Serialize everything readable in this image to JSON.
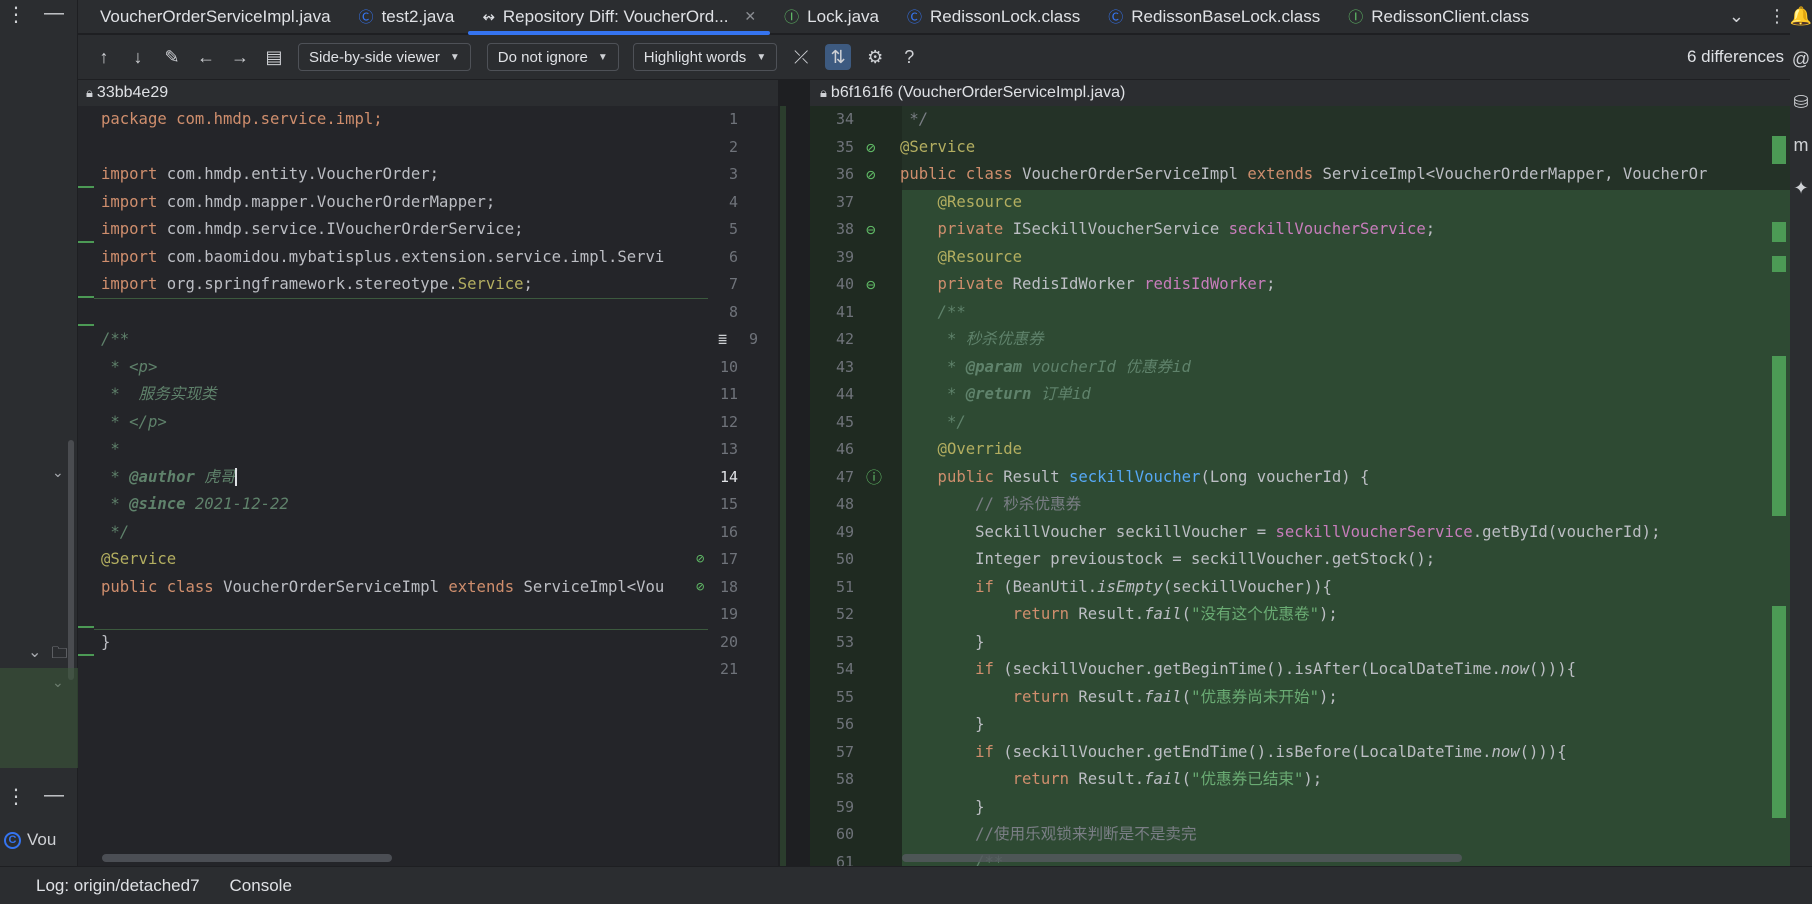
{
  "tabs": [
    {
      "label": "VoucherOrderServiceImpl.java",
      "icon": "file-icon",
      "active": false
    },
    {
      "label": "test2.java",
      "icon": "class-icon",
      "active": false
    },
    {
      "label": "Repository Diff: VoucherOrd...",
      "icon": "diff-icon",
      "active": true
    },
    {
      "label": "Lock.java",
      "icon": "interface-icon",
      "active": false
    },
    {
      "label": "RedissonLock.class",
      "icon": "class-icon",
      "active": false
    },
    {
      "label": "RedissonBaseLock.class",
      "icon": "class-icon",
      "active": false
    },
    {
      "label": "RedissonClient.class",
      "icon": "interface-icon",
      "active": false
    }
  ],
  "toolbar": {
    "viewer": "Side-by-side viewer",
    "ignore": "Do not ignore",
    "highlight": "Highlight words",
    "differences": "6 differences",
    "help": "?"
  },
  "left_pane": {
    "revision": "33bb4e29",
    "current_line": 14
  },
  "right_pane": {
    "revision": "b6f161f6 (VoucherOrderServiceImpl.java)"
  },
  "left_code": {
    "l1": "package com.hmdp.service.impl;",
    "l3a": "import ",
    "l3b": "com.hmdp.entity.VoucherOrder;",
    "l4a": "import ",
    "l4b": "com.hmdp.mapper.VoucherOrderMapper;",
    "l5a": "import ",
    "l5b": "com.hmdp.service.IVoucherOrderService;",
    "l6a": "import ",
    "l6b": "com.baomidou.mybatisplus.extension.service.impl.Servi",
    "l7a": "import ",
    "l7b": "org.springframework.stereotype.",
    "l7c": "Service",
    "l7d": ";",
    "l9": "/**",
    "l10a": " * ",
    "l10b": "<p>",
    "l11": " *  服务实现类",
    "l12a": " * ",
    "l12b": "</p>",
    "l13": " *",
    "l14a": " * ",
    "l14b": "@author",
    "l14c": " 虎哥",
    "l15a": " * ",
    "l15b": "@since",
    "l15c": " 2021-12-22",
    "l16": " */",
    "l17": "@Service",
    "l18a": "public class ",
    "l18b": "VoucherOrderServiceImpl ",
    "l18c": "extends ",
    "l18d": "ServiceImpl<Vou",
    "l20": "}"
  },
  "right_code": {
    "r34": " */",
    "r35": "@Service",
    "r36a": "public class ",
    "r36b": "VoucherOrderServiceImpl ",
    "r36c": "extends ",
    "r36d": "ServiceImpl<VoucherOrderMapper, VoucherOr",
    "r37": "    @Resource",
    "r38a": "    private ",
    "r38b": "ISeckillVoucherService ",
    "r38c": "seckillVoucherService",
    "r38d": ";",
    "r39": "    @Resource",
    "r40a": "    private ",
    "r40b": "RedisIdWorker ",
    "r40c": "redisIdWorker",
    "r40d": ";",
    "r41": "    /**",
    "r42": "     * 秒杀优惠券",
    "r43a": "     * ",
    "r43b": "@param",
    "r43c": " voucherId",
    "r43d": " 优惠券id",
    "r44a": "     * ",
    "r44b": "@return",
    "r44c": " 订单id",
    "r45": "     */",
    "r46": "    @Override",
    "r47a": "    public ",
    "r47b": "Result ",
    "r47c": "seckillVoucher",
    "r47d": "(Long voucherId) {",
    "r48": "        // 秒杀优惠券",
    "r49a": "        SeckillVoucher seckillVoucher = ",
    "r49b": "seckillVoucherService",
    "r49c": ".getById(voucherId);",
    "r50": "        Integer previoustock = seckillVoucher.getStock();",
    "r51a": "        if ",
    "r51b": "(BeanUtil.",
    "r51c": "isEmpty",
    "r51d": "(seckillVoucher)){",
    "r52a": "            return ",
    "r52b": "Result.",
    "r52c": "fail",
    "r52d": "(",
    "r52e": "\"没有这个优惠卷\"",
    "r52f": ");",
    "r53": "        }",
    "r54a": "        if ",
    "r54b": "(seckillVoucher.getBeginTime().isAfter(LocalDateTime.",
    "r54c": "now",
    "r54d": "())){",
    "r55a": "            return ",
    "r55b": "Result.",
    "r55c": "fail",
    "r55d": "(",
    "r55e": "\"优惠券尚未开始\"",
    "r55f": ");",
    "r56": "        }",
    "r57a": "        if ",
    "r57b": "(seckillVoucher.getEndTime().isBefore(LocalDateTime.",
    "r57c": "now",
    "r57d": "())){",
    "r58a": "            return ",
    "r58b": "Result.",
    "r58c": "fail",
    "r58d": "(",
    "r58e": "\"优惠券已结束\"",
    "r58f": ");",
    "r59": "        }",
    "r60": "        //使用乐观锁来判断是不是卖完",
    "r61": "        /**"
  },
  "left_line_numbers": [
    "1",
    "2",
    "3",
    "4",
    "5",
    "6",
    "7",
    "8",
    "9",
    "10",
    "11",
    "12",
    "13",
    "14",
    "15",
    "16",
    "17",
    "18",
    "19",
    "20",
    "21"
  ],
  "right_line_numbers": [
    "34",
    "35",
    "36",
    "37",
    "38",
    "39",
    "40",
    "41",
    "42",
    "43",
    "44",
    "45",
    "46",
    "47",
    "48",
    "49",
    "50",
    "51",
    "52",
    "53",
    "54",
    "55",
    "56",
    "57",
    "58",
    "59",
    "60",
    "61"
  ],
  "left_panel": {
    "run_label": "Vou"
  },
  "bottom_bar": {
    "log": "Log: origin/detached7",
    "console": "Console"
  },
  "colors": {
    "accent": "#3574f0",
    "added_bg": "#2e4a33",
    "added_marker": "#4c9a55",
    "keyword": "#cf8e6d",
    "string": "#6aab73",
    "annotation": "#b3ae60"
  }
}
